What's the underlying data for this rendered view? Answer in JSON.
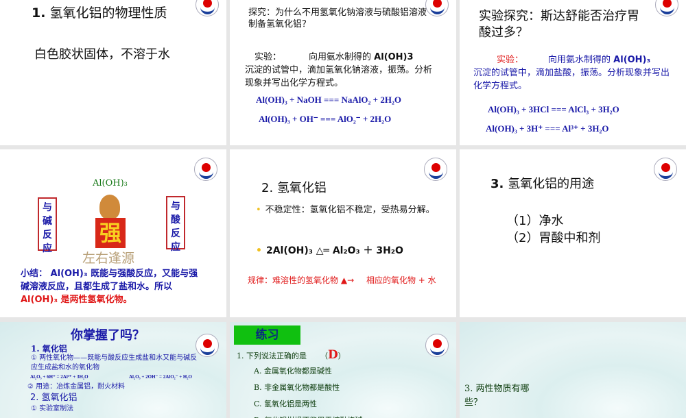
{
  "slides": [
    {
      "title_num": "1.",
      "title": "氢氧化铝的物理性质",
      "body": "白色胶状固体，不溶于水"
    },
    {
      "q": "探究：为什么不用氢氧化钠溶液与硫酸铝溶液制备氢氧化铝？",
      "exp_label": "实验：",
      "exp_text1": "向用氨水制得的",
      "exp_formula": "Al(OH)3",
      "exp_text2": "沉淀的试管中，滴加氢氧化钠溶液，振荡。分析现象并写出化学方程式。",
      "eq1": "Al(OH)₃ + NaOH === NaAlO₂ + 2H₂O",
      "eq2": "Al(OH)₃ + OH⁻ === AlO₂⁻ + 2H₂O"
    },
    {
      "title": "实验探究：斯达舒能否治疗胃酸过多？",
      "exp_label": "实验：",
      "exp_text1": "向用氨水制得的",
      "exp_formula": "Al(OH)₃",
      "exp_text2": "沉淀的试管中，滴加盐酸，振荡。分析现象并写出化学方程式。",
      "eq1": "Al(OH)₃ + 3HCl === AlCl₃ + 3H₂O",
      "eq2": "Al(OH)₃ + 3H⁺ === Al³⁺ + 3H₂O"
    },
    {
      "formula": "Al(OH)₃",
      "left_box": "与碱反应",
      "right_box": "与酸反应",
      "strong": "强",
      "caption": "左右逢源",
      "summary_label": "小结：",
      "summary1": "Al(OH)₃ 既能与强酸反应，又能与强碱溶液反应，且都生成了盐和水。所以",
      "summary_red": "Al(OH)₃ 是两性氢氧化物。"
    },
    {
      "title": "2. 氢氧化铝",
      "bullet1": "不稳定性：氢氧化铝不稳定，受热易分解。",
      "bullet2": "2Al(OH)₃ △═ Al₂O₃ ＋ 3H₂O",
      "rule_left": "规律：难溶性的氢氧化物",
      "rule_right": "相应的氧化物 + 水"
    },
    {
      "title_num": "3.",
      "title": "氢氧化铝的用途",
      "items": [
        "（1）净水",
        "（2）胃酸中和剂"
      ]
    },
    {
      "title": "你掌握了吗？",
      "h1": "1. 氧化铝",
      "p1": "① 两性氧化物——既能与酸反应生成盐和水又能与碱反应生成盐和水的氧化物",
      "eq1": "Al₂O₃ + 6H⁺ = 2Al³⁺ + 3H₂O",
      "eq2": "Al₂O₃ + 2OH⁻ = 2AlO₂⁻ + H₂O",
      "p2": "② 用途：冶炼金属铝，耐火材料",
      "h2": "2. 氢氧化铝",
      "p3": "① 实验室制法"
    },
    {
      "badge": "练习",
      "q": "1. 下列说法正确的是",
      "answer": "D",
      "paren_open": "（",
      "paren_close": "）",
      "options": [
        "A. 金属氧化物都是碱性",
        "B. 非金属氧化物都是酸性",
        "C. 氢氧化铝是两性",
        "D. 氧化铝坩埚不能用于熔融烧碱"
      ]
    },
    {
      "q": "3. 两性物质有哪些？"
    }
  ]
}
